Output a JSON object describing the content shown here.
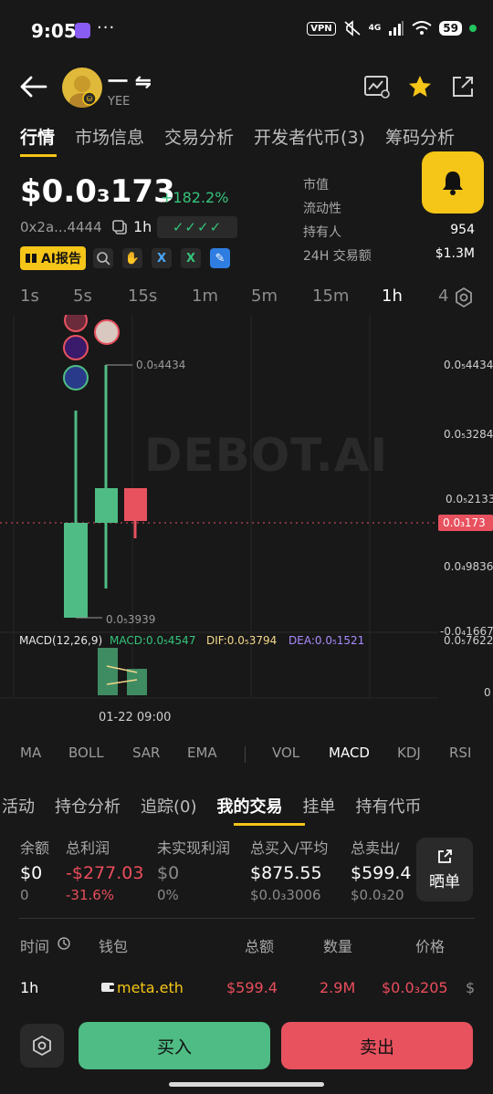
{
  "status_bar": {
    "time": "9:05",
    "dots": "···",
    "vpn": "VPN",
    "network": "4G",
    "battery": "59"
  },
  "header": {
    "token_name": "一 ⇋",
    "token_sub": "YEE"
  },
  "tabs": [
    {
      "label": "行情",
      "active": true
    },
    {
      "label": "市场信息",
      "active": false
    },
    {
      "label": "交易分析",
      "active": false
    },
    {
      "label": "开发者代币(3)",
      "active": false
    },
    {
      "label": "筹码分析",
      "active": false
    }
  ],
  "price": {
    "value": "$0.0₃173",
    "change": "+182.2%",
    "address": "0x2a...4444",
    "interval": "1h",
    "checks": "✓✓✓✓",
    "change_color": "#35c47c"
  },
  "badges": {
    "ai_report": "AI报告",
    "x1": "X",
    "x2": "X"
  },
  "stats": [
    {
      "label": "市值",
      "value": ""
    },
    {
      "label": "流动性",
      "value": ""
    },
    {
      "label": "持有人",
      "value": "954"
    },
    {
      "label": "24H 交易额",
      "value": "$1.3M"
    }
  ],
  "timeframes": [
    "1s",
    "5s",
    "15s",
    "1m",
    "5m",
    "15m",
    "1h",
    "4"
  ],
  "active_timeframe": "1h",
  "chart": {
    "watermark": "DEBOT.AI",
    "high_label": "0.0₅4434",
    "low_label": "0.0₅3939",
    "macd_title": "MACD(12,26,9)",
    "macd_value": "MACD:0.0₅4547",
    "dif_value": "DIF:0.0₅3794",
    "dea_value": "DEA:0.0₅1521",
    "date_label": "01-22 09:00"
  },
  "chart_data": {
    "type": "candlestick",
    "price_axis_labels": [
      "0.0₅4434",
      "0.0₅3284",
      "0.0₅2133",
      "0.0₄9836",
      "-0.0₄1667"
    ],
    "macd_axis_labels": [
      "0.0₅7622",
      "0"
    ],
    "current_price_label": "0.0₃173",
    "x_label": "01-22 09:00",
    "candles": [
      {
        "direction": "up"
      },
      {
        "direction": "up"
      },
      {
        "direction": "down"
      }
    ],
    "colors": {
      "up": "#4ebc84",
      "down": "#e8525f"
    }
  },
  "indicators": {
    "main": [
      "MA",
      "BOLL",
      "SAR",
      "EMA"
    ],
    "sub": [
      "VOL",
      "MACD",
      "KDJ",
      "RSI"
    ],
    "active": "MACD"
  },
  "lower_tabs": [
    {
      "label": "活动",
      "active": false
    },
    {
      "label": "持仓分析",
      "active": false
    },
    {
      "label": "追踪(0)",
      "active": false
    },
    {
      "label": "我的交易",
      "active": true
    },
    {
      "label": "挂单",
      "active": false
    },
    {
      "label": "持有代币",
      "active": false
    }
  ],
  "summary": [
    {
      "label": "余额",
      "value": "$0",
      "sub": "0"
    },
    {
      "label": "总利润",
      "value": "-$277.03",
      "sub": "-31.6%"
    },
    {
      "label": "未实现利润",
      "value": "$0",
      "sub": "0%"
    },
    {
      "label": "总买入/平均",
      "value": "$875.55",
      "sub": "$0.0₃3006"
    },
    {
      "label": "总卖出/",
      "value": "$599.4",
      "sub": "$0.0₃20"
    }
  ],
  "share_label": "晒单",
  "trades": {
    "headers": [
      "时间",
      "钱包",
      "总额",
      "数量",
      "价格"
    ],
    "rows": [
      {
        "time": "1h",
        "wallet": "meta.eth",
        "total": "$599.4",
        "quantity": "2.9M",
        "price": "$0.0₃205",
        "extra": "$"
      }
    ]
  },
  "actions": {
    "buy": "买入",
    "sell": "卖出"
  }
}
